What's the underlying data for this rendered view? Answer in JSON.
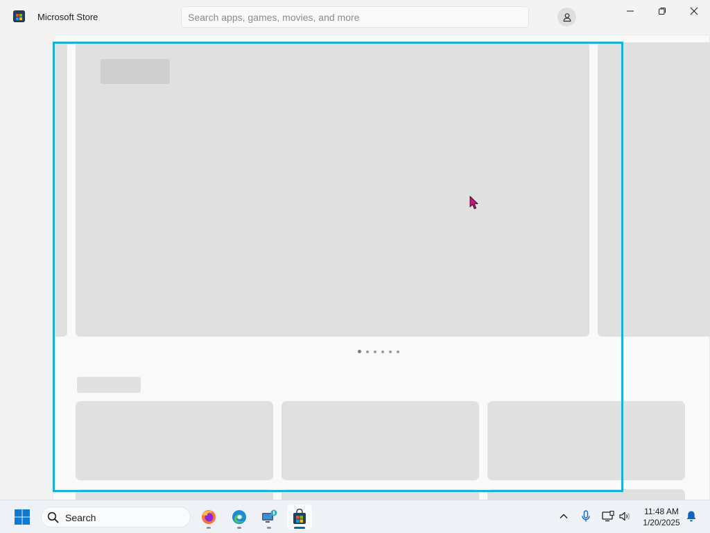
{
  "window": {
    "title": "Microsoft Store",
    "search_placeholder": "Search apps, games, movies, and more",
    "controls": [
      "minimize",
      "maximize",
      "close"
    ]
  },
  "colors": {
    "highlight_border": "#1ab0d8",
    "skeleton": "#e0e0e0",
    "accent": "#0067c0",
    "cursor": "#c8157e"
  },
  "content": {
    "state": "loading-skeleton",
    "carousel_page_count": 6,
    "carousel_active_index": 0,
    "card_rows": 2,
    "cards_per_row": 3
  },
  "taskbar": {
    "search_label": "Search",
    "apps": [
      {
        "name": "Firefox",
        "icon": "firefox-icon",
        "active": false
      },
      {
        "name": "Microsoft Edge",
        "icon": "edge-icon",
        "active": false
      },
      {
        "name": "Computer",
        "icon": "computer-icon",
        "active": false
      },
      {
        "name": "Microsoft Store",
        "icon": "store-icon",
        "active": true
      }
    ],
    "tray_icons": [
      "chevron-up-icon",
      "microphone-icon",
      "display-icon",
      "volume-icon",
      "notification-bell-icon"
    ]
  },
  "clock": {
    "time": "11:48 AM",
    "date": "1/20/2025"
  }
}
